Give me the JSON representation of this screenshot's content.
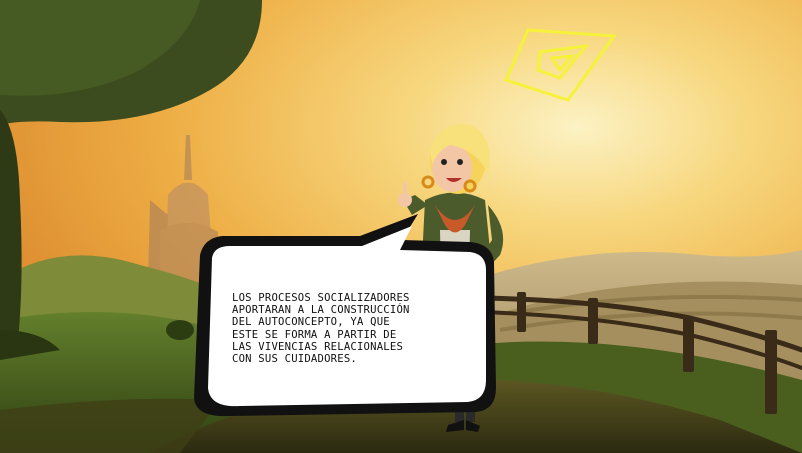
{
  "scene": {
    "bubble_lines": [
      "LOS PROCESOS SOCIALIZADORES",
      "APORTARAN A LA CONSTRUCCIÓN",
      "DEL AUTOCONCEPTO, YA QUE",
      "ESTE SE FORMA A PARTIR DE",
      "LAS VIVENCIAS RELACIONALES",
      "CON SUS CUIDADORES."
    ],
    "colors": {
      "sky_glow": "#fbeaa0",
      "sky_warm": "#f3b64a",
      "sky_dark": "#e08a2a",
      "tree": "#3a4a1e",
      "hill": "#c7ad7c",
      "grass": "#4f6a22",
      "path": "#3b3a16",
      "logo": "#f6f23a",
      "bubble_fill": "#ffffff",
      "bubble_shadow": "#111111"
    },
    "icons": [
      "logo-diamond-icon"
    ]
  }
}
